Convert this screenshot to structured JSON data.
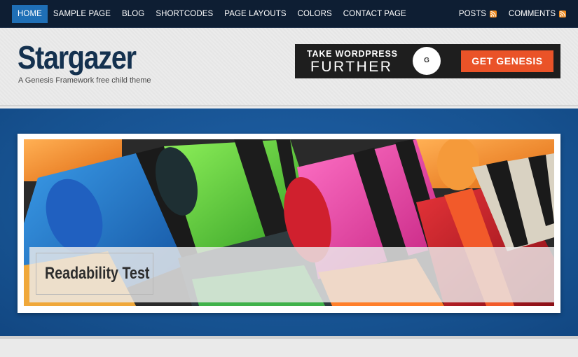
{
  "nav": {
    "items": [
      {
        "label": "Home",
        "active": true
      },
      {
        "label": "Sample Page",
        "active": false
      },
      {
        "label": "Blog",
        "active": false
      },
      {
        "label": "Shortcodes",
        "active": false
      },
      {
        "label": "Page Layouts",
        "active": false
      },
      {
        "label": "Colors",
        "active": false
      },
      {
        "label": "Contact Page",
        "active": false
      }
    ],
    "feeds": [
      {
        "label": "Posts",
        "icon": "rss-icon"
      },
      {
        "label": "Comments",
        "icon": "rss-icon"
      }
    ]
  },
  "header": {
    "title": "Stargazer",
    "description": "A Genesis Framework free child theme"
  },
  "banner": {
    "line1": "TAKE WORDPRESS",
    "line2": "FURTHER",
    "logo_text": "G",
    "button_label": "GET GENESIS"
  },
  "slider": {
    "caption": "Readability Test",
    "image": "crayons-photo"
  },
  "colors": {
    "nav_bg": "#0e1e33",
    "nav_active": "#1f6fb6",
    "title": "#14314f",
    "band": "#16518f",
    "cta": "#ea5328",
    "rss": "#ef8a1e"
  }
}
